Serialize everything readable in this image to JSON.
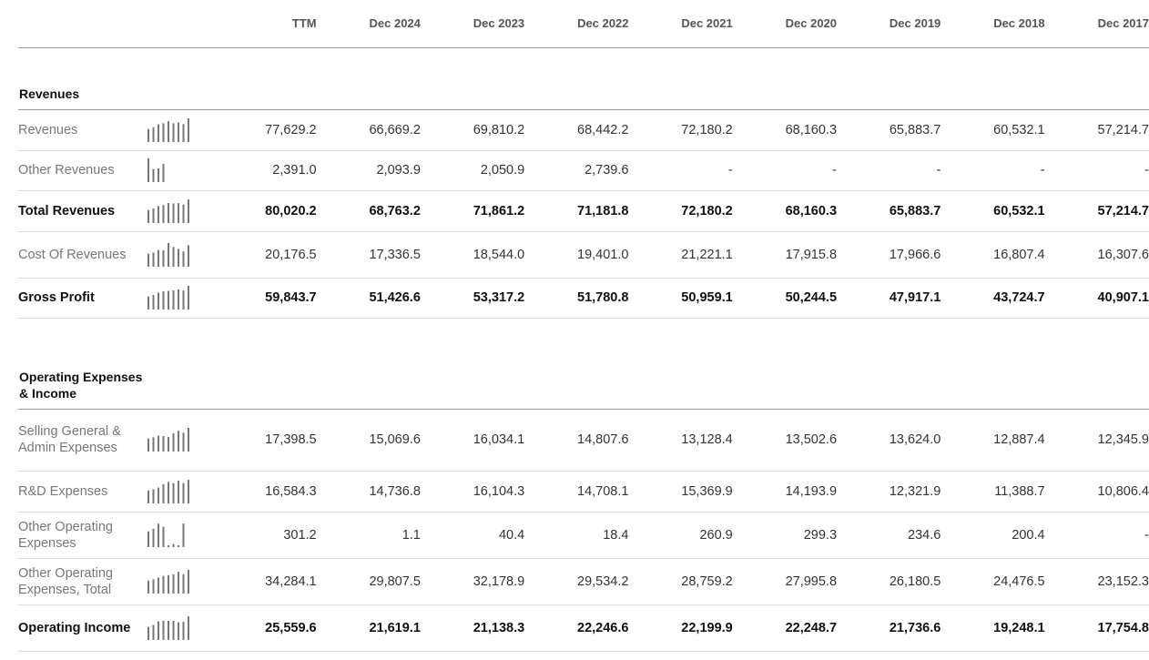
{
  "columns": [
    "TTM",
    "Dec 2024",
    "Dec 2023",
    "Dec 2022",
    "Dec 2021",
    "Dec 2020",
    "Dec 2019",
    "Dec 2018",
    "Dec 2017"
  ],
  "colors": {
    "spark": "#777777",
    "rule": "#9a9a9a",
    "row_rule": "#dcdcdc"
  },
  "sections": [
    {
      "title": "Revenues",
      "rows": [
        {
          "label": "Revenues",
          "bold": false,
          "values": [
            "77,629.2",
            "66,669.2",
            "69,810.2",
            "68,442.2",
            "72,180.2",
            "68,160.3",
            "65,883.7",
            "60,532.1",
            "57,214.7"
          ],
          "spark": [
            77629.2,
            66669.2,
            69810.2,
            68442.2,
            72180.2,
            68160.3,
            65883.7,
            60532.1,
            57214.7
          ]
        },
        {
          "label": "Other Revenues",
          "bold": false,
          "values": [
            "2,391.0",
            "2,093.9",
            "2,050.9",
            "2,739.6",
            "-",
            "-",
            "-",
            "-",
            "-"
          ],
          "spark": [
            2391.0,
            2093.9,
            2050.9,
            2739.6
          ]
        },
        {
          "label": "Total Revenues",
          "bold": true,
          "values": [
            "80,020.2",
            "68,763.2",
            "71,861.2",
            "71,181.8",
            "72,180.2",
            "68,160.3",
            "65,883.7",
            "60,532.1",
            "57,214.7"
          ],
          "spark": [
            80020.2,
            68763.2,
            71861.2,
            71181.8,
            72180.2,
            68160.3,
            65883.7,
            60532.1,
            57214.7
          ]
        },
        {
          "label": "Cost Of Revenues",
          "bold": false,
          "values": [
            "20,176.5",
            "17,336.5",
            "18,544.0",
            "19,401.0",
            "21,221.1",
            "17,915.8",
            "17,966.6",
            "16,807.4",
            "16,307.6"
          ],
          "spark": [
            20176.5,
            17336.5,
            18544.0,
            19401.0,
            21221.1,
            17915.8,
            17966.6,
            16807.4,
            16307.6
          ]
        },
        {
          "label": "Gross Profit",
          "bold": true,
          "values": [
            "59,843.7",
            "51,426.6",
            "53,317.2",
            "51,780.8",
            "50,959.1",
            "50,244.5",
            "47,917.1",
            "43,724.7",
            "40,907.1"
          ],
          "spark": [
            59843.7,
            51426.6,
            53317.2,
            51780.8,
            50959.1,
            50244.5,
            47917.1,
            43724.7,
            40907.1
          ]
        }
      ]
    },
    {
      "title": "Operating Expenses & Income",
      "rows": [
        {
          "label": "Selling General & Admin Expenses",
          "bold": false,
          "values": [
            "17,398.5",
            "15,069.6",
            "16,034.1",
            "14,807.6",
            "13,128.4",
            "13,502.6",
            "13,624.0",
            "12,887.4",
            "12,345.9"
          ],
          "spark": [
            17398.5,
            15069.6,
            16034.1,
            14807.6,
            13128.4,
            13502.6,
            13624.0,
            12887.4,
            12345.9
          ]
        },
        {
          "label": "R&D Expenses",
          "bold": false,
          "values": [
            "16,584.3",
            "14,736.8",
            "16,104.3",
            "14,708.1",
            "15,369.9",
            "14,193.9",
            "12,321.9",
            "11,388.7",
            "10,806.4"
          ],
          "spark": [
            16584.3,
            14736.8,
            16104.3,
            14708.1,
            15369.9,
            14193.9,
            12321.9,
            11388.7,
            10806.4
          ]
        },
        {
          "label": "Other Operating Expenses",
          "bold": false,
          "values": [
            "301.2",
            "1.1",
            "40.4",
            "18.4",
            "260.9",
            "299.3",
            "234.6",
            "200.4",
            "-"
          ],
          "spark": [
            301.2,
            1.1,
            40.4,
            18.4,
            260.9,
            299.3,
            234.6,
            200.4
          ]
        },
        {
          "label": "Other Operating Expenses, Total",
          "bold": false,
          "values": [
            "34,284.1",
            "29,807.5",
            "32,178.9",
            "29,534.2",
            "28,759.2",
            "27,995.8",
            "26,180.5",
            "24,476.5",
            "23,152.3"
          ],
          "spark": [
            34284.1,
            29807.5,
            32178.9,
            29534.2,
            28759.2,
            27995.8,
            26180.5,
            24476.5,
            23152.3
          ]
        },
        {
          "label": "Operating Income",
          "bold": true,
          "values": [
            "25,559.6",
            "21,619.1",
            "21,138.3",
            "22,246.6",
            "22,199.9",
            "22,248.7",
            "21,736.6",
            "19,248.1",
            "17,754.8"
          ],
          "spark": [
            25559.6,
            21619.1,
            21138.3,
            22246.6,
            22199.9,
            22248.7,
            21736.6,
            19248.1,
            17754.8
          ]
        }
      ]
    }
  ]
}
